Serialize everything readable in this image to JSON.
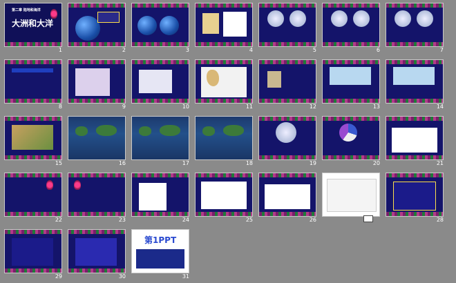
{
  "slides": [
    {
      "n": "1",
      "title": "大洲和大洋",
      "subtitle": "第二章 陆地和海洋"
    },
    {
      "n": "2"
    },
    {
      "n": "3"
    },
    {
      "n": "4"
    },
    {
      "n": "5"
    },
    {
      "n": "6"
    },
    {
      "n": "7"
    },
    {
      "n": "8"
    },
    {
      "n": "9"
    },
    {
      "n": "10"
    },
    {
      "n": "11"
    },
    {
      "n": "12"
    },
    {
      "n": "13"
    },
    {
      "n": "14"
    },
    {
      "n": "15"
    },
    {
      "n": "16"
    },
    {
      "n": "17"
    },
    {
      "n": "18"
    },
    {
      "n": "19"
    },
    {
      "n": "20"
    },
    {
      "n": "21"
    },
    {
      "n": "22"
    },
    {
      "n": "23"
    },
    {
      "n": "24"
    },
    {
      "n": "25"
    },
    {
      "n": "26"
    },
    {
      "n": "27"
    },
    {
      "n": "28"
    },
    {
      "n": "29"
    },
    {
      "n": "30"
    },
    {
      "n": "31",
      "logo": "第1PPT"
    }
  ],
  "colors": {
    "background": "#8a8a8a",
    "slide_bg": "#16167a",
    "accent_red": "#ff3b3b",
    "accent_yellow": "#ffe04a"
  }
}
